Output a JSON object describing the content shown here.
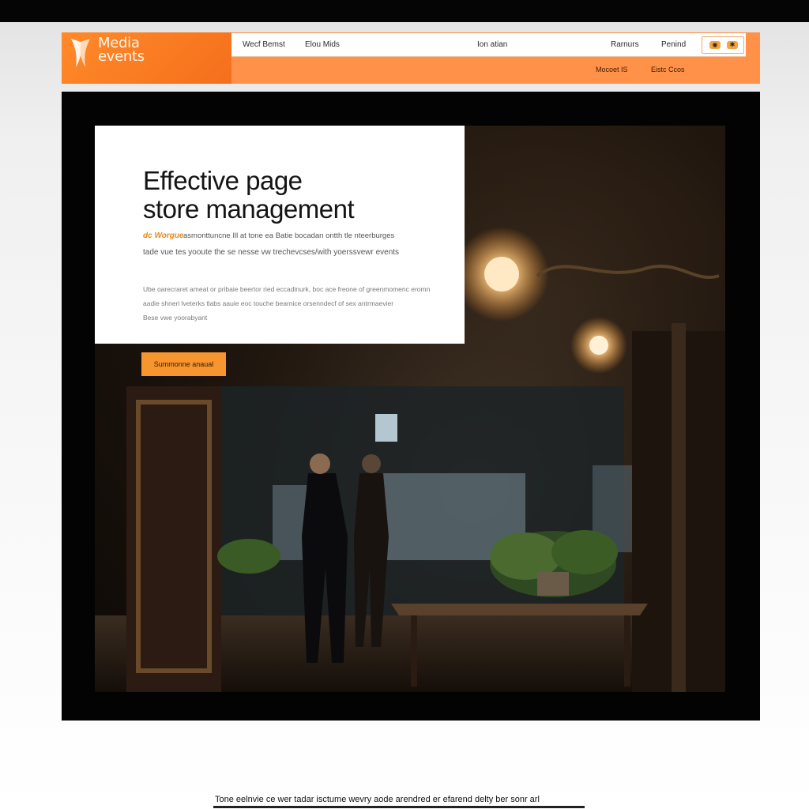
{
  "header": {
    "logo": {
      "line1": "Media",
      "line2": "events"
    },
    "nav": [
      "Wecf Bemst",
      "Elou Mids",
      "Ion atian",
      "Rarnurs",
      "Penind"
    ],
    "icons": [
      "camera-icon",
      "settings-icon"
    ],
    "subnav": [
      "Mocoet IS",
      "Eistc Ccos"
    ]
  },
  "hero": {
    "title_line1": "Effective page",
    "title_line2": "store management",
    "lead_highlight": "dc Worgue",
    "lead_line1": "asmonttuncne Ill at tone ea Batie bocadan ontth tle nteerburges",
    "lead_line2": "tade vue tes yooute the se nesse vw trechevcses/with yoerssvewr events",
    "body_lines": [
      "Ube oarecraret ameat or pribaie beertor ried eccadinurk, boc ace freone of greenmomenc eromn",
      "aadie shneri lveterks tlabs aauie eoc touche bearnice orsenndecf of sex antrmaevier",
      "Bese vwe yoorabyant"
    ],
    "cta_label": "Summonne anaual"
  },
  "footer": {
    "text": "Tone eelnvie ce wer tadar isctume wevry aode arendred er efarend delty ber sonr arl"
  },
  "colors": {
    "accent": "#f7962f",
    "nav_bar": "#ff9248",
    "logo_bg": "#ff8a2a",
    "frame": "#030303"
  }
}
